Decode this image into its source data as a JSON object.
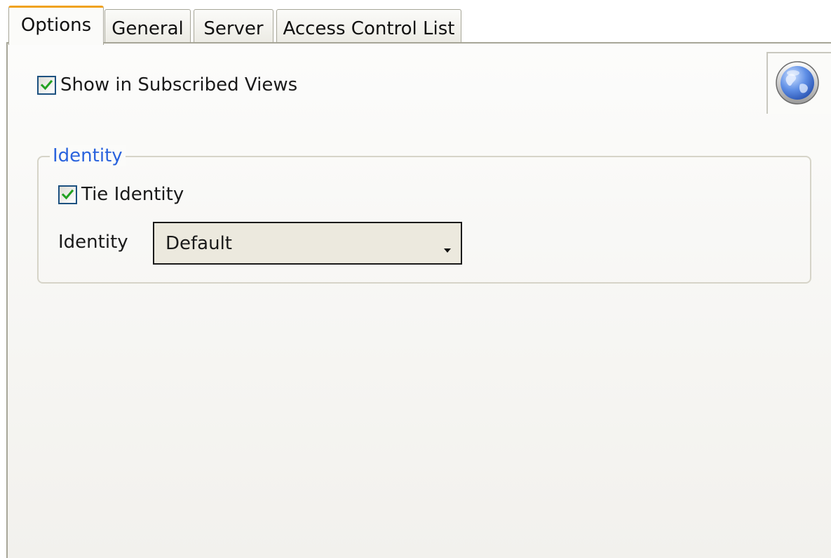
{
  "tabs": [
    {
      "label": "Options",
      "active": true
    },
    {
      "label": "General",
      "active": false
    },
    {
      "label": "Server",
      "active": false
    },
    {
      "label": "Access Control List",
      "active": false
    }
  ],
  "options": {
    "show_subscribed": {
      "label": "Show in Subscribed Views",
      "checked": true
    },
    "globe_icon": "globe-icon"
  },
  "identity_group": {
    "title": "Identity",
    "tie_identity": {
      "label": "Tie Identity",
      "checked": true
    },
    "identity_label": "Identity",
    "identity_select": {
      "value": "Default"
    }
  },
  "colors": {
    "active_tab_accent": "#f0a21e",
    "group_title": "#2a63dd",
    "check_mark": "#21a121",
    "checkbox_border": "#1d5180"
  }
}
